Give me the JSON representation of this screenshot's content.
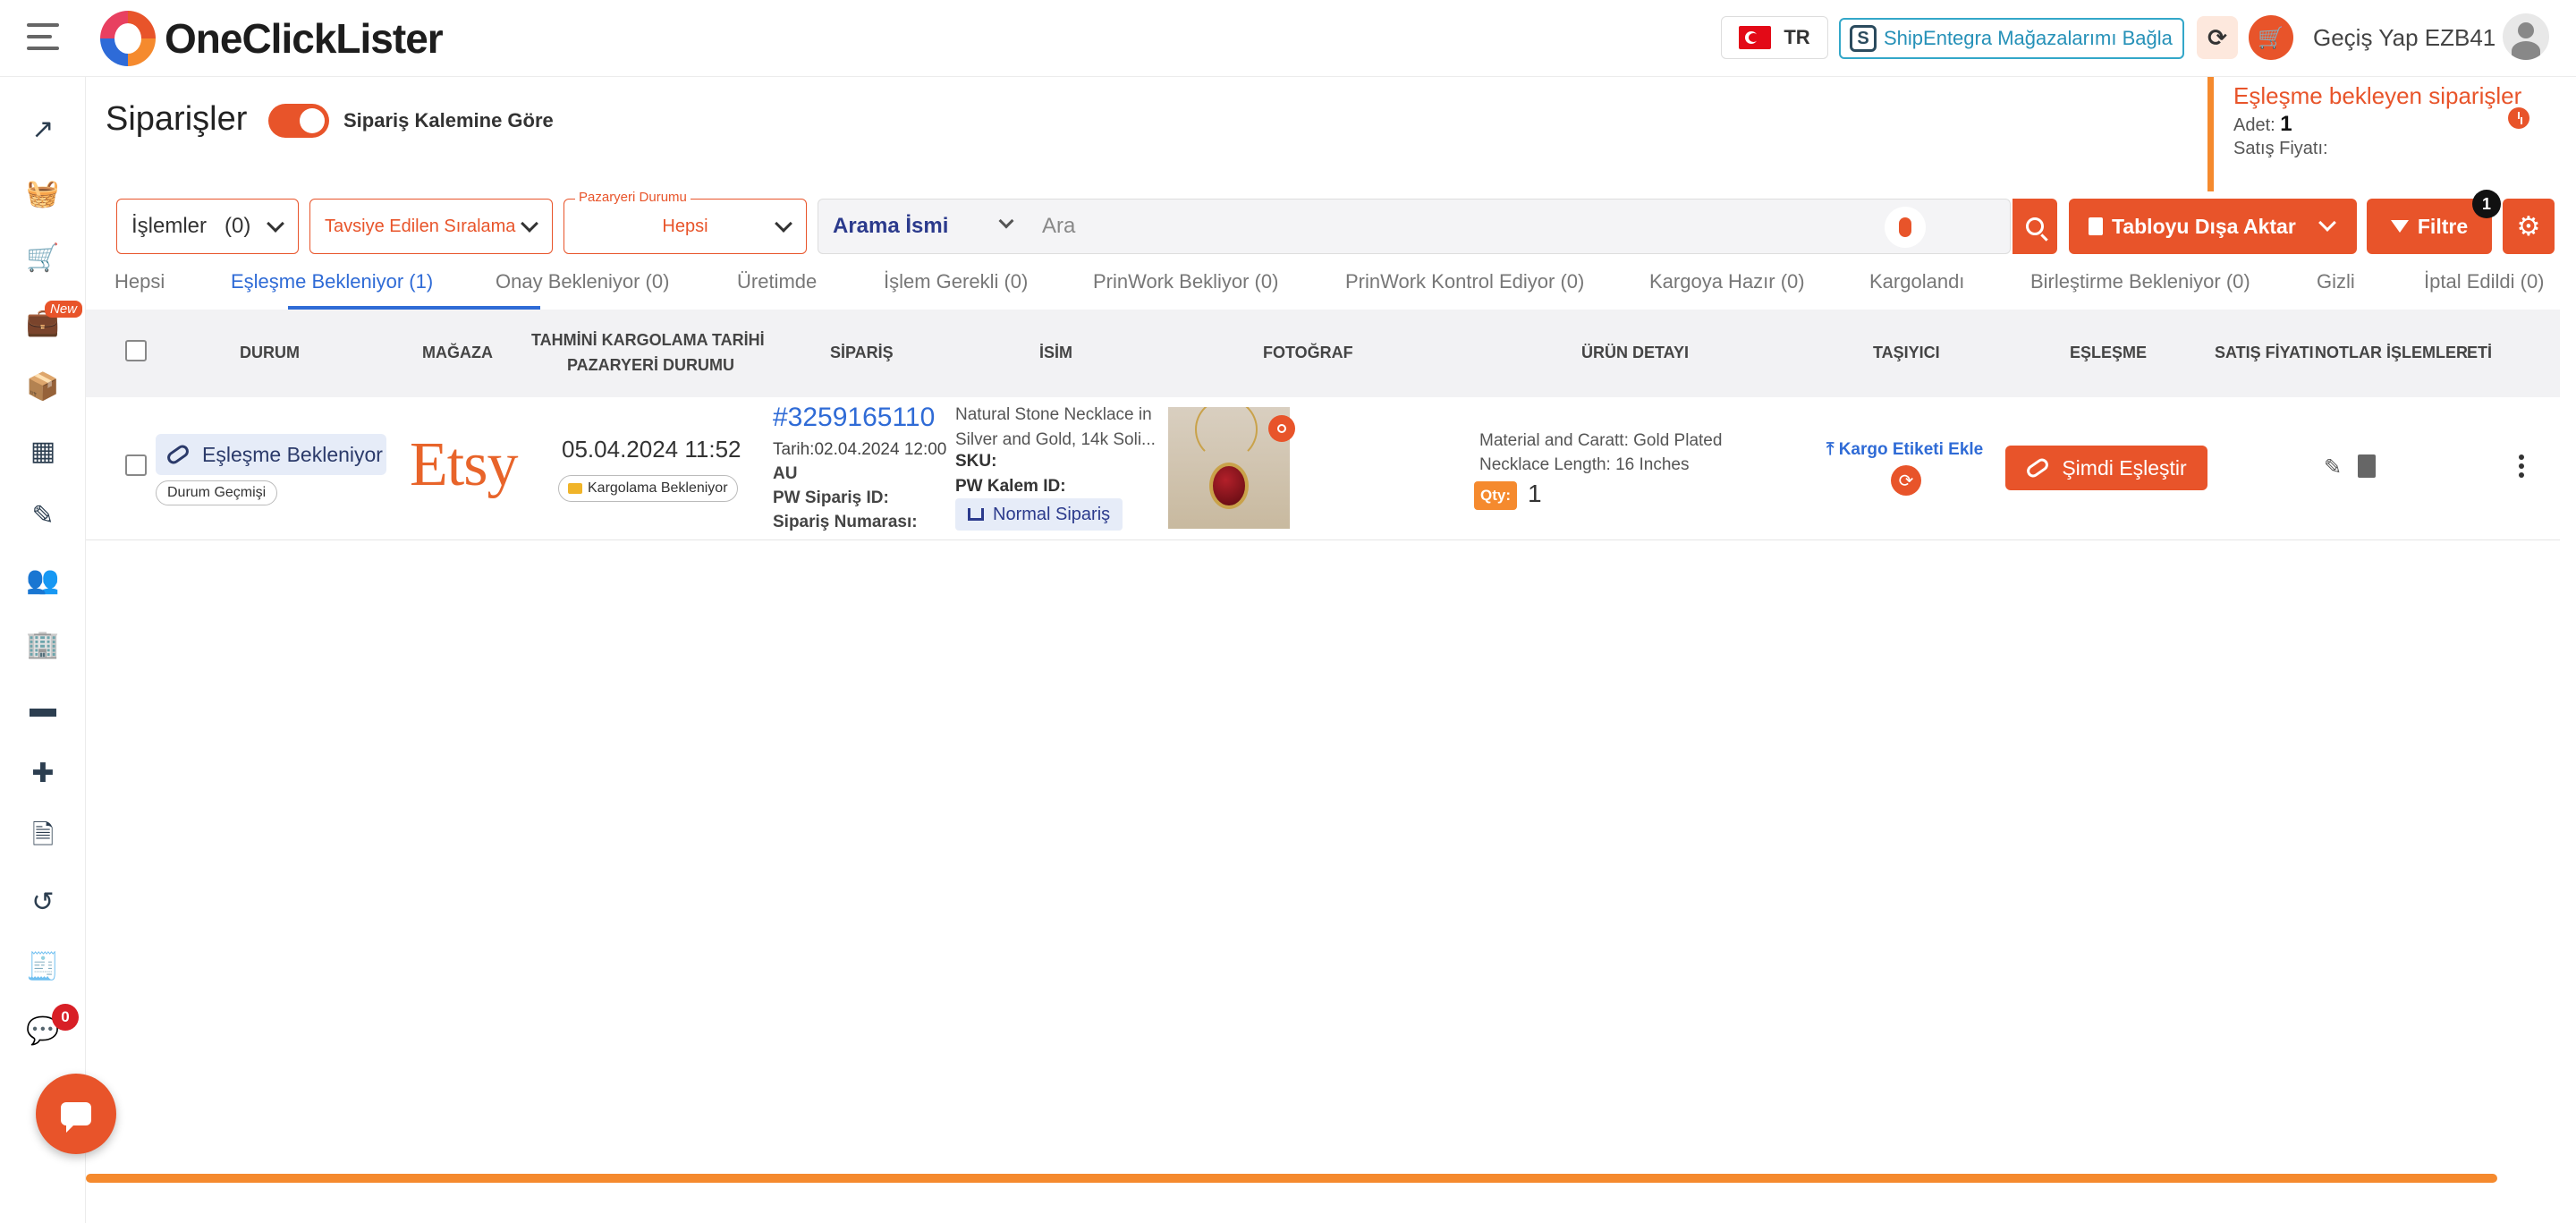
{
  "header": {
    "brand": "OneClickLister",
    "language": "TR",
    "shipentegra_label": "ShipEntegra Mağazalarımı Bağla",
    "user_label": "Geçiş Yap EZB41"
  },
  "sidebar": {
    "new_badge": "New",
    "messages_count": "0",
    "icons": [
      "trending-up-icon",
      "basket-icon",
      "cart-plus-icon",
      "briefcase-icon",
      "box-open-icon",
      "boxes-icon",
      "edit-document-icon",
      "users-icon",
      "building-shield-icon",
      "wallet-icon",
      "puzzle-icon",
      "file-check-icon",
      "history-icon",
      "receipt-icon",
      "chat-icon"
    ]
  },
  "page": {
    "title": "Siparişler",
    "toggle_label": "Sipariş Kalemine Göre",
    "toggle_on": true
  },
  "pending_panel": {
    "title": "Eşleşme bekleyen siparişler",
    "count_label": "Adet:",
    "count_value": "1",
    "price_label": "Satış Fiyatı:"
  },
  "filters": {
    "operations_label": "İşlemler",
    "operations_count": "(0)",
    "sort_label": "Tavsiye Edilen Sıralama",
    "market_float_label": "Pazaryeri Durumu",
    "market_value": "Hepsi",
    "search_field": "Arama İsmi",
    "search_placeholder": "Ara",
    "export_label": "Tabloyu Dışa Aktar",
    "filter_label": "Filtre",
    "filter_count": "1"
  },
  "tabs": [
    {
      "label": "Hepsi"
    },
    {
      "label": "Eşleşme Bekleniyor (1)",
      "active": true
    },
    {
      "label": "Onay Bekleniyor (0)"
    },
    {
      "label": "Üretimde"
    },
    {
      "label": "İşlem Gerekli (0)"
    },
    {
      "label": "PrinWork Bekliyor (0)"
    },
    {
      "label": "PrinWork Kontrol Ediyor (0)"
    },
    {
      "label": "Kargoya Hazır (0)"
    },
    {
      "label": "Kargolandı"
    },
    {
      "label": "Birleştirme Bekleniyor (0)"
    },
    {
      "label": "Gizli"
    },
    {
      "label": "İptal Edildi (0)"
    }
  ],
  "table": {
    "headers": {
      "status": "DURUM",
      "store": "MAĞAZA",
      "ship_date_1": "TAHMİNİ KARGOLAMA TARİHİ",
      "ship_date_2": "PAZARYERİ DURUMU",
      "order": "SİPARİŞ",
      "name": "İSİM",
      "photo": "FOTOĞRAF",
      "product_detail": "ÜRÜN DETAYI",
      "carrier": "TAŞIYICI",
      "matching": "EŞLEŞME",
      "price": "SATIŞ FİYATI",
      "notes": "NOTLAR",
      "actions": "İŞLEMLER",
      "extra": "ETİ"
    },
    "rows": [
      {
        "status": "Eşleşme Bekleniyor",
        "status_history": "Durum Geçmişi",
        "store": "Etsy",
        "ship_date": "05.04.2024 11:52",
        "marketplace_status": "Kargolama Bekleniyor",
        "order_no": "#3259165110",
        "order_date": "Tarih:02.04.2024 12:00",
        "country": "AU",
        "pw_order_label": "PW Sipariş ID:",
        "order_number_label": "Sipariş Numarası:",
        "name_text": "Natural Stone Necklace in Silver and Gold, 14k Soli...",
        "sku_label": "SKU:",
        "pw_item_label": "PW Kalem ID:",
        "order_type": "Normal Sipariş",
        "detail_1_key": "Material and Caratt:",
        "detail_1_val": "Gold Plated",
        "detail_2_key": "Necklace Length:",
        "detail_2_val": "16 Inches",
        "qty_label": "Qty:",
        "qty_value": "1",
        "carrier_action": "Kargo Etiketi Ekle",
        "match_action": "Şimdi Eşleştir"
      }
    ]
  }
}
